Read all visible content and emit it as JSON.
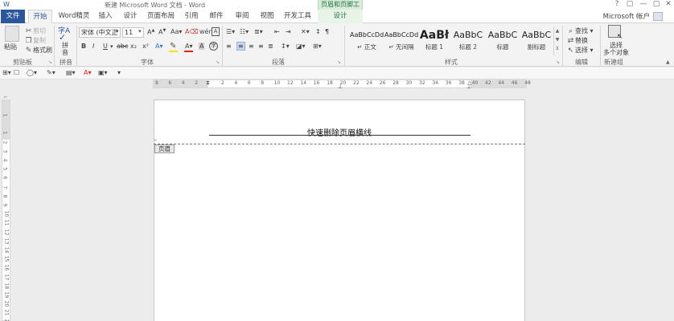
{
  "window": {
    "title": "新建 Microsoft Word 文档 - Word",
    "context_tool": "页眉和页脚工具",
    "controls": [
      "?",
      "▢",
      "—",
      "▢",
      "✕"
    ],
    "account": "Microsoft 帐户"
  },
  "tabs": [
    "文件",
    "开始",
    "Word精灵",
    "插入",
    "设计",
    "页面布局",
    "引用",
    "邮件",
    "审阅",
    "视图",
    "开发工具",
    "设计"
  ],
  "ribbon": {
    "clipboard": {
      "paste": "粘贴",
      "cut": "剪切",
      "copy": "复制",
      "format_painter": "格式刷",
      "label": "剪贴板"
    },
    "pinyin": {
      "button_line1": "拼",
      "button_line2": "音",
      "label": "拼音"
    },
    "font": {
      "name": "宋体 (中文正",
      "size": "11",
      "label": "字体",
      "bold": "B",
      "italic": "I",
      "underline": "U",
      "strike": "abc",
      "sub": "x₂",
      "sup": "x²"
    },
    "paragraph": {
      "label": "段落"
    },
    "styles": {
      "items": [
        {
          "sample": "AaBbCcDd",
          "name": "↵ 正文"
        },
        {
          "sample": "AaBbCcDd",
          "name": "↵ 无间隔"
        },
        {
          "sample": "AaBł",
          "name": "标题 1"
        },
        {
          "sample": "AaBbC",
          "name": "标题 2"
        },
        {
          "sample": "AaBbC",
          "name": "标题"
        },
        {
          "sample": "AaBbC",
          "name": "副标题"
        }
      ],
      "label": "样式"
    },
    "editing": {
      "find": "查找",
      "replace": "替换",
      "select": "选择",
      "label": "编辑"
    },
    "new_group": {
      "line1": "选择",
      "line2": "多个对象",
      "label": "新建组"
    }
  },
  "ruler": {
    "h_numbers": [
      "8",
      "6",
      "4",
      "2",
      "",
      "2",
      "4",
      "6",
      "8",
      "10",
      "12",
      "14",
      "16",
      "18",
      "20",
      "22",
      "24",
      "26",
      "28",
      "30",
      "32",
      "34",
      "36",
      "38",
      "40",
      "42",
      "44",
      "46",
      "48"
    ],
    "v_numbers": [
      "1",
      "",
      "1",
      "2",
      "3",
      "4",
      "5",
      "6",
      "7",
      "8",
      "9",
      "10",
      "11",
      "12",
      "13",
      "14",
      "15",
      "16",
      "17",
      "18",
      "19",
      "20",
      "21",
      "22",
      "23"
    ]
  },
  "document": {
    "header_text": "快速删除页眉横线",
    "header_tag": "页眉"
  },
  "colors": {
    "file_tab": "#2b579a",
    "context_green": "#217346",
    "font_color_red": "#e02020",
    "highlight_yellow": "#ffe000"
  }
}
